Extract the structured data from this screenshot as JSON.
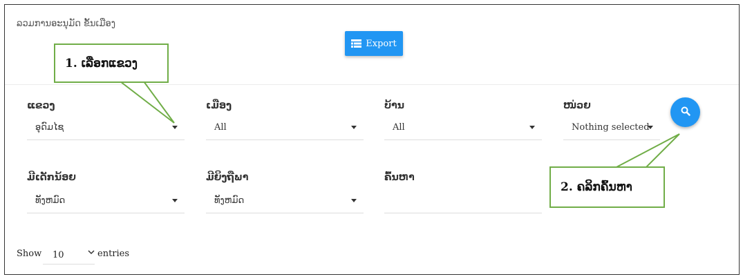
{
  "page": {
    "title": "ລວມການອະນຸມັດ ຂັ້ນເມືອງ"
  },
  "toolbar": {
    "export_label": "Export",
    "export_icon": "table-icon"
  },
  "filters": {
    "province": {
      "label": "ແຂວງ",
      "value": "ອຸດົມໄຊ"
    },
    "district": {
      "label": "ເມືອງ",
      "value": "All"
    },
    "village": {
      "label": "ບ້ານ",
      "value": "All"
    },
    "unit": {
      "label": "ໜ່ວຍ",
      "value": "Nothing selected"
    },
    "child_under5": {
      "label": "ມີເດັກນ້ອຍ",
      "value": "ທັງຫມົດ"
    },
    "disabled": {
      "label": "ມີຍິງຖືພາ",
      "value": "ທັງຫມົດ"
    },
    "search": {
      "label": "ຄົ້ນຫາ",
      "value": ""
    },
    "search_icon": "search-icon"
  },
  "table_length": {
    "show_label": "Show",
    "value": "10",
    "entries_label": "entries"
  },
  "callouts": {
    "step1": "1. ເລືອກແຂວງ",
    "step2": "2. ຄລິກຄົ້ນຫາ"
  },
  "colors": {
    "accent": "#2196f3",
    "callout_border": "#70ad47"
  }
}
